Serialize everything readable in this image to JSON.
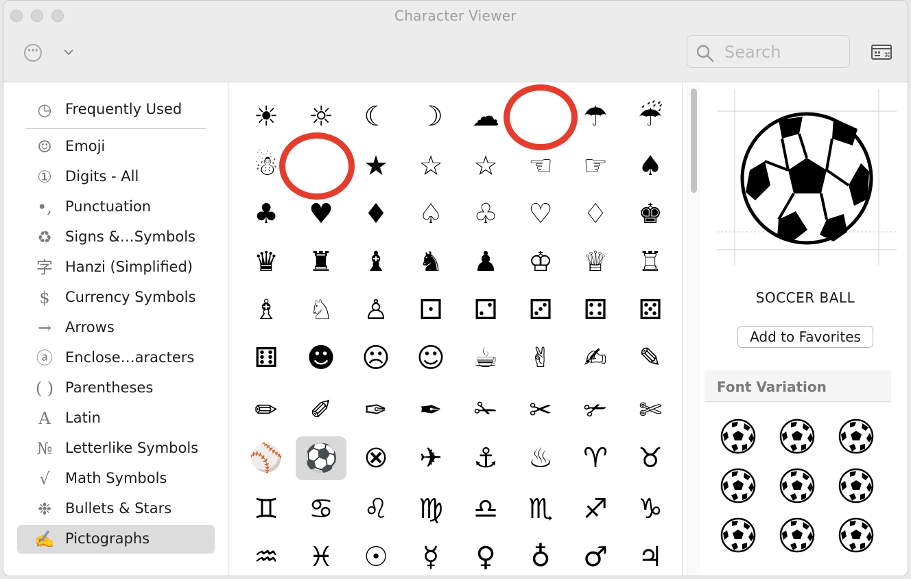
{
  "window": {
    "title": "Character Viewer",
    "search_placeholder": "Search"
  },
  "sidebar": {
    "items": [
      {
        "label": "Frequently Used",
        "icon": "clock-icon",
        "glyph": "◷"
      },
      {
        "label": "Emoji",
        "icon": "smiley-icon",
        "glyph": "☺"
      },
      {
        "label": "Digits - All",
        "icon": "circled-one-icon",
        "glyph": "①"
      },
      {
        "label": "Punctuation",
        "icon": "punctuation-icon",
        "glyph": "•,"
      },
      {
        "label": "Signs &…Symbols",
        "icon": "recycle-icon",
        "glyph": "♻"
      },
      {
        "label": "Hanzi (Simplified)",
        "icon": "hanzi-icon",
        "glyph": "字"
      },
      {
        "label": "Currency Symbols",
        "icon": "dollar-icon",
        "glyph": "$"
      },
      {
        "label": "Arrows",
        "icon": "arrow-icon",
        "glyph": "→"
      },
      {
        "label": "Enclose…aracters",
        "icon": "circled-a-icon",
        "glyph": "ⓐ"
      },
      {
        "label": "Parentheses",
        "icon": "parentheses-icon",
        "glyph": "( )"
      },
      {
        "label": "Latin",
        "icon": "latin-a-icon",
        "glyph": "A"
      },
      {
        "label": "Letterlike Symbols",
        "icon": "numero-icon",
        "glyph": "№"
      },
      {
        "label": "Math Symbols",
        "icon": "square-root-icon",
        "glyph": "√"
      },
      {
        "label": "Bullets & Stars",
        "icon": "asterisk-icon",
        "glyph": "❉"
      },
      {
        "label": "Pictographs",
        "icon": "writing-hand-icon",
        "glyph": "✍",
        "selected": true
      }
    ]
  },
  "grid": {
    "rows": [
      [
        "☀",
        "☼",
        "☾",
        "☽",
        "☁",
        "",
        "☂",
        "☔"
      ],
      [
        "☃",
        "",
        "★",
        "☆",
        "☆",
        "☜",
        "☞",
        "♠"
      ],
      [
        "♣",
        "♥",
        "♦",
        "♤",
        "♧",
        "♡",
        "♢",
        "♚"
      ],
      [
        "♛",
        "♜",
        "♝",
        "♞",
        "♟",
        "♔",
        "♕",
        "♖"
      ],
      [
        "♗",
        "♘",
        "♙",
        "⚀",
        "⚁",
        "⚂",
        "⚃",
        "⚄"
      ],
      [
        "⚅",
        "☻",
        "☹",
        "☺",
        "☕",
        "✌",
        "✍",
        "✎"
      ],
      [
        "✏",
        "✐",
        "✑",
        "✒",
        "✁",
        "✂",
        "✃",
        "✄"
      ],
      [
        "⚾",
        "⚽",
        "⮿",
        "✈",
        "⚓",
        "♨",
        "♈",
        "♉"
      ],
      [
        "♊",
        "♋",
        "♌",
        "♍",
        "♎",
        "♏",
        "♐",
        "♑"
      ],
      [
        "♒",
        "♓",
        "☉",
        "☿",
        "♀",
        "♁",
        "♂",
        "♃"
      ]
    ],
    "selected": "⚽"
  },
  "inspector": {
    "preview_glyph": "⚽",
    "character_name": "SOCCER BALL",
    "add_favorites_label": "Add to Favorites",
    "font_variation_title": "Font Variation",
    "variations": [
      "⚽",
      "⚽",
      "⚽",
      "⚽",
      "⚽",
      "⚽",
      "⚽",
      "⚽",
      "⚽"
    ]
  },
  "annotations": {
    "ring_color": "#e43d2e"
  },
  "colors": {
    "selection": "#dcdcdc",
    "window_chrome": "#ececec"
  }
}
